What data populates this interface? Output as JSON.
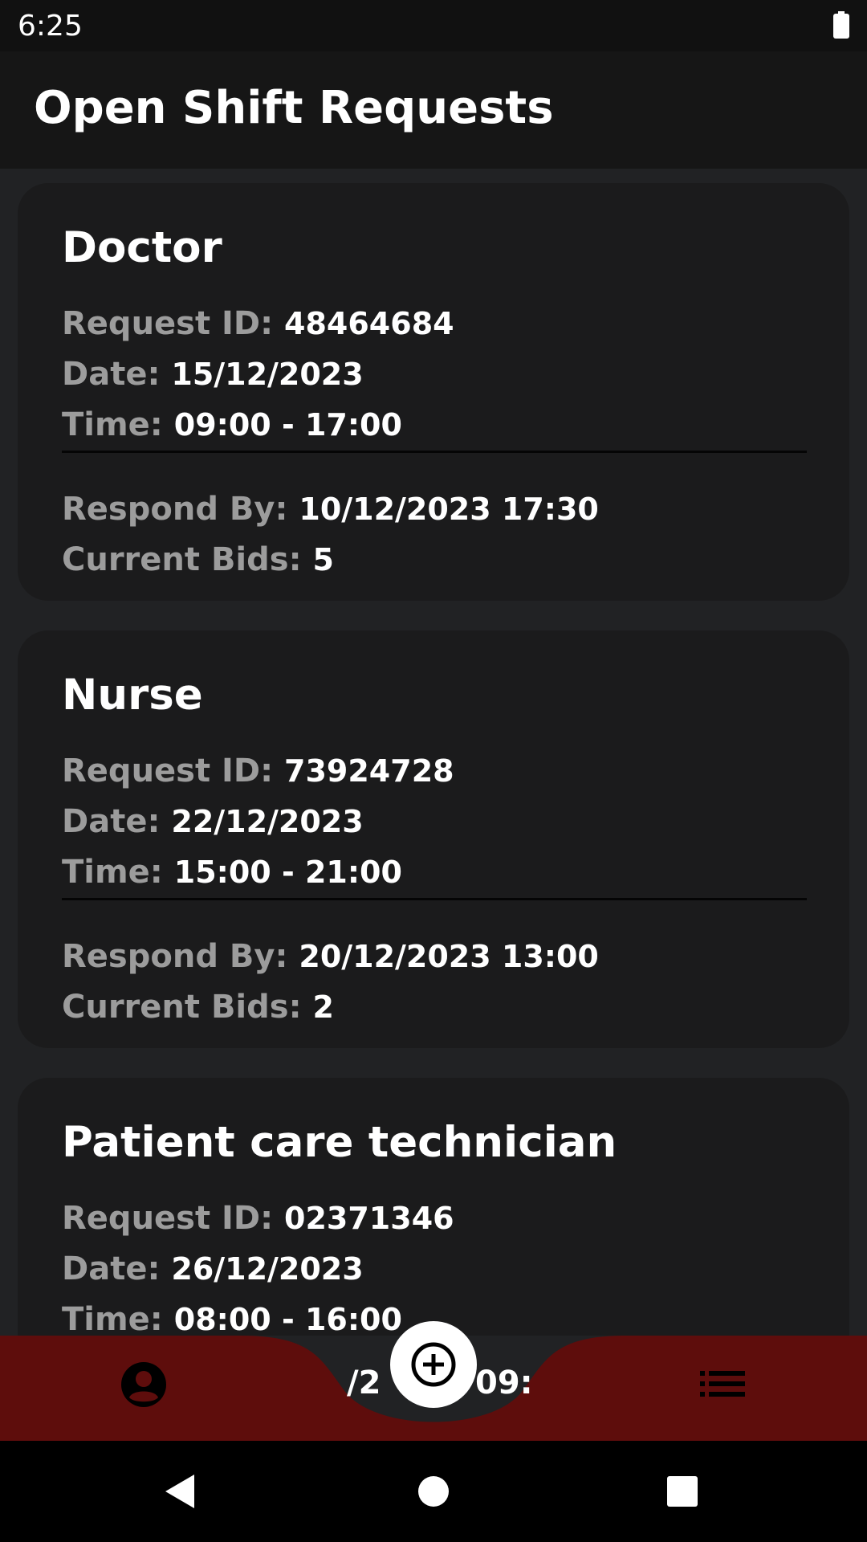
{
  "status_bar": {
    "time": "6:25"
  },
  "app_bar": {
    "title": "Open Shift Requests"
  },
  "labels": {
    "request_id": "Request ID:",
    "date": "Date:",
    "time": "Time:",
    "respond_by": "Respond By:",
    "current_bids": "Current Bids:"
  },
  "requests": [
    {
      "role": "Doctor",
      "request_id": "48464684",
      "date": "15/12/2023",
      "time": "09:00 - 17:00",
      "respond_by": "10/12/2023 17:30",
      "current_bids": "5"
    },
    {
      "role": "Nurse",
      "request_id": "73924728",
      "date": "22/12/2023",
      "time": "15:00 - 21:00",
      "respond_by": "20/12/2023 13:00",
      "current_bids": "2"
    },
    {
      "role": "Patient care technician",
      "request_id": "02371346",
      "date": "26/12/2023",
      "time": "08:00 - 16:00",
      "respond_by_partial": "/2",
      "respond_by_partial_2": "09:"
    }
  ],
  "colors": {
    "bottom_bar": "#5e0d0c",
    "background": "#212224",
    "card": "#1b1b1c",
    "label": "#9c9c9c"
  },
  "icons": {
    "profile": "account-circle-icon",
    "add": "add-circle-icon",
    "list": "list-icon"
  }
}
